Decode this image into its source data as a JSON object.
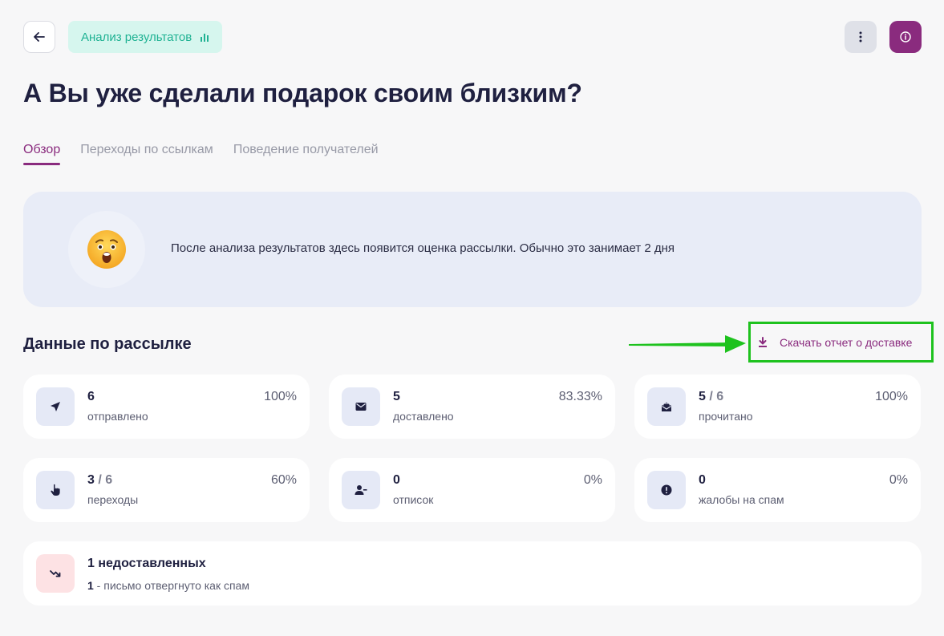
{
  "header": {
    "badge_label": "Анализ результатов",
    "icons": {
      "back": "arrow-left-icon",
      "badge": "bar-chart-icon",
      "more": "more-vertical-icon",
      "info": "info-icon"
    },
    "colors": {
      "badge_bg": "#d6f6ee",
      "badge_text": "#1fb293",
      "info_bg": "#8a2b7e"
    }
  },
  "page_title": "А Вы уже сделали подарок своим близким?",
  "tabs": [
    {
      "label": "Обзор",
      "active": true
    },
    {
      "label": "Переходы по ссылкам",
      "active": false
    },
    {
      "label": "Поведение получателей",
      "active": false
    }
  ],
  "notice": {
    "emoji_icon": "astonished-face-icon",
    "text": "После анализа результатов здесь появится оценка рассылки. Обычно это занимает 2 дня"
  },
  "section": {
    "title": "Данные по рассылке",
    "download_label": "Скачать отчет о доставке",
    "download_icon": "download-icon"
  },
  "stats": [
    {
      "value": "6",
      "total": "",
      "label": "отправлено",
      "percent": "100%",
      "icon": "send-icon"
    },
    {
      "value": "5",
      "total": "",
      "label": "доставлено",
      "percent": "83.33%",
      "icon": "envelope-icon"
    },
    {
      "value": "5",
      "total": "6",
      "label": "прочитано",
      "percent": "100%",
      "icon": "envelope-open-icon"
    },
    {
      "value": "3",
      "total": "6",
      "label": "переходы",
      "percent": "60%",
      "icon": "pointer-hand-icon"
    },
    {
      "value": "0",
      "total": "",
      "label": "отписок",
      "percent": "0%",
      "icon": "user-minus-icon"
    },
    {
      "value": "0",
      "total": "",
      "label": "жалобы на спам",
      "percent": "0%",
      "icon": "alert-circle-icon"
    }
  ],
  "undelivered": {
    "title": "1 недоставленных",
    "count": "1",
    "reason": " - письмо отвергнуто как спам",
    "icon": "trend-down-icon"
  },
  "colors": {
    "accent": "#8a2b7e",
    "highlight": "#1ec21e"
  }
}
